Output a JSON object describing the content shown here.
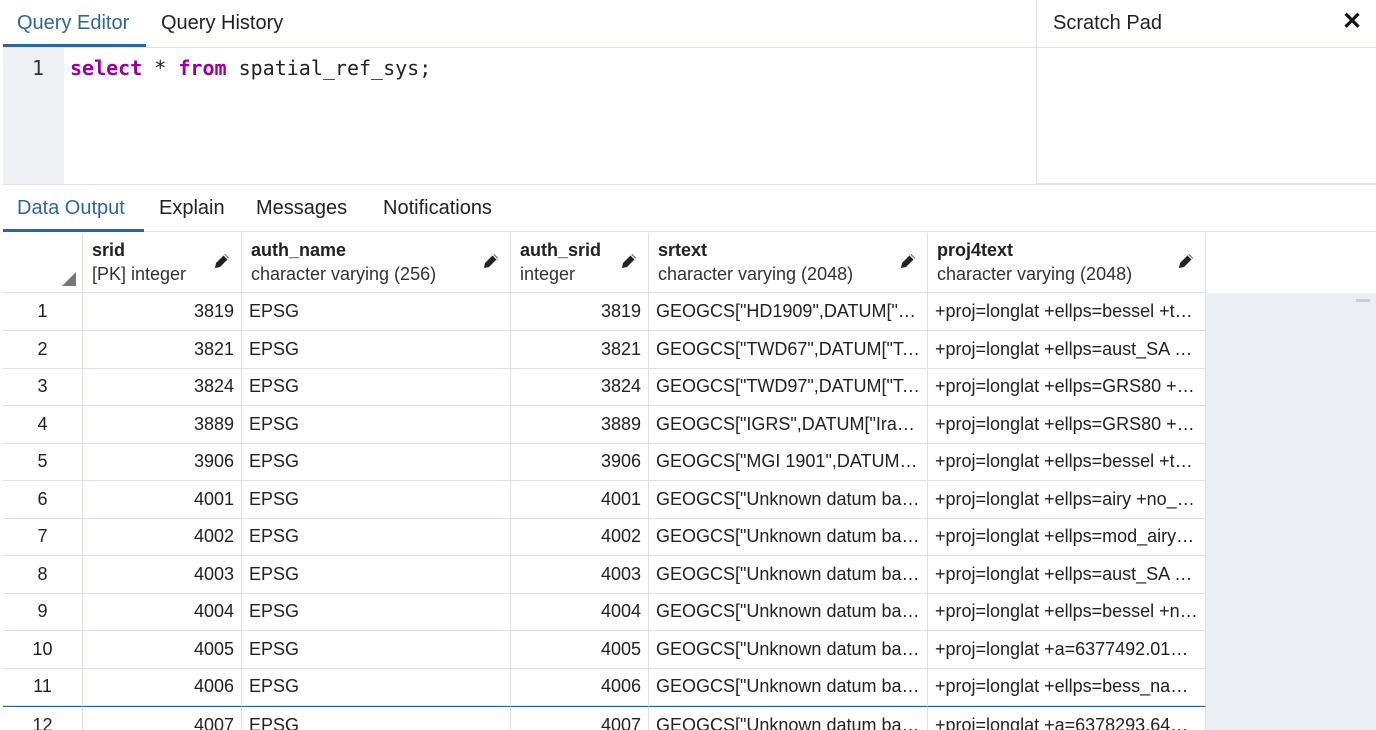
{
  "tabs": {
    "query_editor": "Query Editor",
    "query_history": "Query History"
  },
  "scratch_pad": {
    "title": "Scratch Pad",
    "close": "✕"
  },
  "editor": {
    "line_number": "1",
    "kw_select": "select",
    "star": " * ",
    "kw_from": "from",
    "rest": " spatial_ref_sys;"
  },
  "output_tabs": [
    "Data Output",
    "Explain",
    "Messages",
    "Notifications"
  ],
  "columns": [
    {
      "name": "srid",
      "type": "[PK] integer"
    },
    {
      "name": "auth_name",
      "type": "character varying (256)"
    },
    {
      "name": "auth_srid",
      "type": "integer"
    },
    {
      "name": "srtext",
      "type": "character varying (2048)"
    },
    {
      "name": "proj4text",
      "type": "character varying (2048)"
    }
  ],
  "rows": [
    [
      "1",
      "3819",
      "EPSG",
      "3819",
      "GEOGCS[\"HD1909\",DATUM[\"Hu…",
      "+proj=longlat +ellps=bessel +to…"
    ],
    [
      "2",
      "3821",
      "EPSG",
      "3821",
      "GEOGCS[\"TWD67\",DATUM[\"Tai…",
      "+proj=longlat +ellps=aust_SA +…"
    ],
    [
      "3",
      "3824",
      "EPSG",
      "3824",
      "GEOGCS[\"TWD97\",DATUM[\"Tai…",
      "+proj=longlat +ellps=GRS80 +t…"
    ],
    [
      "4",
      "3889",
      "EPSG",
      "3889",
      "GEOGCS[\"IGRS\",DATUM[\"Iraqi_…",
      "+proj=longlat +ellps=GRS80 +t…"
    ],
    [
      "5",
      "3906",
      "EPSG",
      "3906",
      "GEOGCS[\"MGI 1901\",DATUM[\"…",
      "+proj=longlat +ellps=bessel +to…"
    ],
    [
      "6",
      "4001",
      "EPSG",
      "4001",
      "GEOGCS[\"Unknown datum bas…",
      "+proj=longlat +ellps=airy +no_d…"
    ],
    [
      "7",
      "4002",
      "EPSG",
      "4002",
      "GEOGCS[\"Unknown datum bas…",
      "+proj=longlat +ellps=mod_airy …"
    ],
    [
      "8",
      "4003",
      "EPSG",
      "4003",
      "GEOGCS[\"Unknown datum bas…",
      "+proj=longlat +ellps=aust_SA +…"
    ],
    [
      "9",
      "4004",
      "EPSG",
      "4004",
      "GEOGCS[\"Unknown datum bas…",
      "+proj=longlat +ellps=bessel +n…"
    ],
    [
      "10",
      "4005",
      "EPSG",
      "4005",
      "GEOGCS[\"Unknown datum bas…",
      "+proj=longlat +a=6377492.018 …"
    ],
    [
      "11",
      "4006",
      "EPSG",
      "4006",
      "GEOGCS[\"Unknown datum bas…",
      "+proj=longlat +ellps=bess_nam…"
    ],
    [
      "12",
      "4007",
      "EPSG",
      "4007",
      "GEOGCS[\"Unknown datum bas…",
      "+proj=longlat +a=6378293.645…"
    ]
  ],
  "colors": {
    "accent": "#326690",
    "keyword": "#990099"
  }
}
